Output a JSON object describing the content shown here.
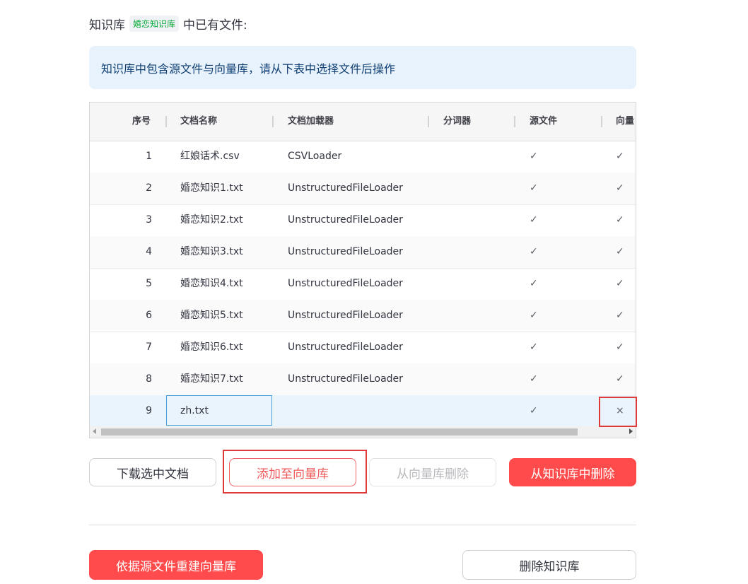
{
  "header": {
    "prefix": "知识库",
    "kb_name": "婚恋知识库",
    "suffix": "中已有文件:"
  },
  "info": {
    "text": "知识库中包含源文件与向量库，请从下表中选择文件后操作"
  },
  "table": {
    "columns": [
      "序号",
      "文档名称",
      "文档加载器",
      "分词器",
      "源文件",
      "向量"
    ],
    "rows": [
      {
        "no": "1",
        "name": "红娘话术.csv",
        "loader": "CSVLoader",
        "splitter": "",
        "src": "✓",
        "vec": "✓"
      },
      {
        "no": "2",
        "name": "婚恋知识1.txt",
        "loader": "UnstructuredFileLoader",
        "splitter": "",
        "src": "✓",
        "vec": "✓"
      },
      {
        "no": "3",
        "name": "婚恋知识2.txt",
        "loader": "UnstructuredFileLoader",
        "splitter": "",
        "src": "✓",
        "vec": "✓"
      },
      {
        "no": "4",
        "name": "婚恋知识3.txt",
        "loader": "UnstructuredFileLoader",
        "splitter": "",
        "src": "✓",
        "vec": "✓"
      },
      {
        "no": "5",
        "name": "婚恋知识4.txt",
        "loader": "UnstructuredFileLoader",
        "splitter": "",
        "src": "✓",
        "vec": "✓"
      },
      {
        "no": "6",
        "name": "婚恋知识5.txt",
        "loader": "UnstructuredFileLoader",
        "splitter": "",
        "src": "✓",
        "vec": "✓"
      },
      {
        "no": "7",
        "name": "婚恋知识6.txt",
        "loader": "UnstructuredFileLoader",
        "splitter": "",
        "src": "✓",
        "vec": "✓"
      },
      {
        "no": "8",
        "name": "婚恋知识7.txt",
        "loader": "UnstructuredFileLoader",
        "splitter": "",
        "src": "✓",
        "vec": "✓"
      },
      {
        "no": "9",
        "name": "zh.txt",
        "loader": "",
        "splitter": "",
        "src": "✓",
        "vec": "×"
      }
    ]
  },
  "buttons": {
    "download": "下载选中文档",
    "add_to_vector": "添加至向量库",
    "remove_from_vector": "从向量库删除",
    "delete_from_kb": "从知识库中删除",
    "rebuild": "依据源文件重建向量库",
    "delete_kb": "删除知识库"
  },
  "colors": {
    "primary": "#ff4b4b",
    "highlight_box": "#e03939",
    "info_bg": "#e8f2fc",
    "selected_row": "#eaf4fd"
  }
}
